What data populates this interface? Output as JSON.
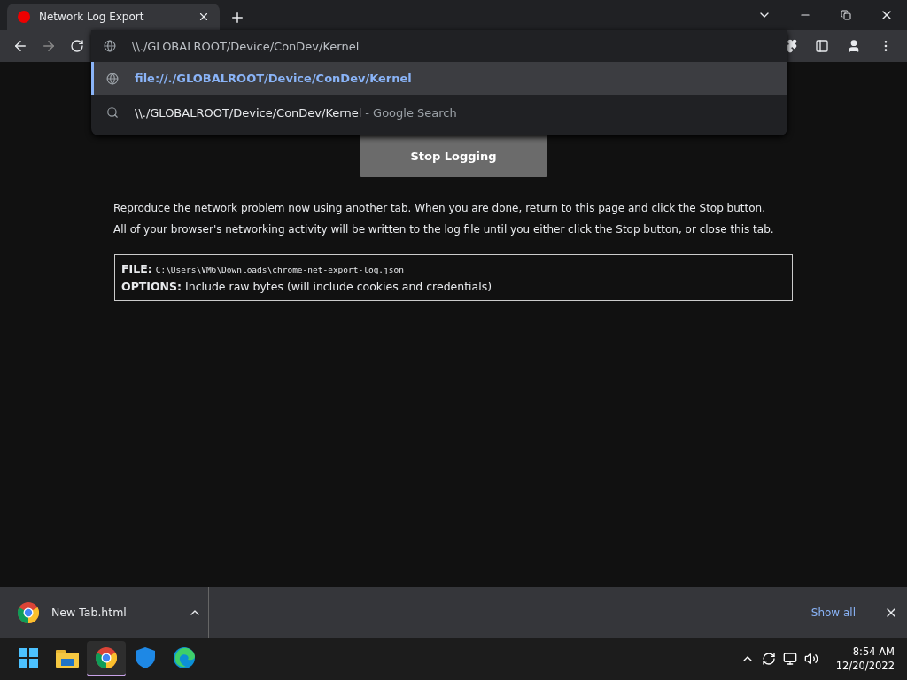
{
  "tab": {
    "title": "Network Log Export",
    "recording": true
  },
  "address": {
    "value": "\\\\./GLOBALROOT/Device/ConDev/Kernel"
  },
  "suggestions": [
    {
      "kind": "url",
      "text": "file://./GLOBALROOT/Device/ConDev/Kernel",
      "selected": true
    },
    {
      "kind": "search",
      "text": "\\\\./GLOBALROOT/Device/ConDev/Kernel",
      "suffix": "- Google Search",
      "selected": false
    }
  ],
  "stop_button": "Stop Logging",
  "paragraphs": [
    "Reproduce the network problem now using another tab. When you are done, return to this page and click the Stop button.",
    "All of your browser's networking activity will be written to the log file until you either click the Stop button, or close this tab."
  ],
  "info": [
    {
      "label": "FILE:",
      "value": "C:\\Users\\VM6\\Downloads\\chrome-net-export-log.json",
      "kind": "mono"
    },
    {
      "label": "OPTIONS:",
      "value": "Include raw bytes (will include cookies and credentials)",
      "kind": "text"
    }
  ],
  "downloads": {
    "file": "New Tab.html",
    "show_all": "Show all"
  },
  "taskbar": {
    "apps": [
      {
        "kind": "start",
        "selected": false
      },
      {
        "kind": "folder",
        "selected": false
      },
      {
        "kind": "chrome",
        "selected": true
      },
      {
        "kind": "shield",
        "selected": false
      },
      {
        "kind": "edge",
        "selected": false
      }
    ],
    "time": "8:54 AM",
    "date": "12/20/2022"
  }
}
